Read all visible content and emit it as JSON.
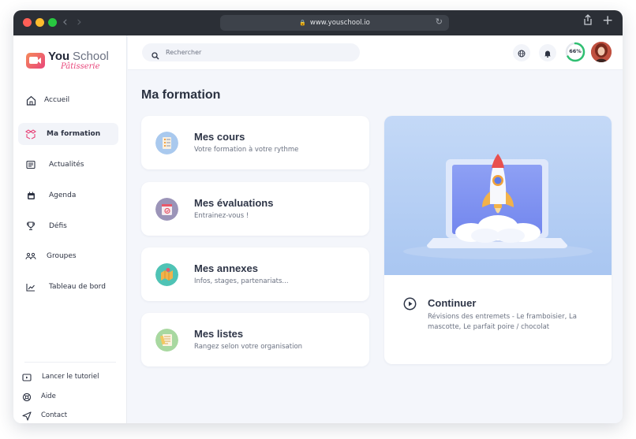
{
  "browser": {
    "url": "www.youschool.io",
    "traffic_colors": [
      "#ff5f57",
      "#febc2e",
      "#28c840"
    ]
  },
  "brand": {
    "name_bold": "You",
    "name_light": "School",
    "tagline": "Pâtisserie",
    "accent": "#e8457a"
  },
  "sidebar": {
    "items": [
      {
        "label": "Accueil",
        "icon": "home-icon"
      },
      {
        "label": "Ma formation",
        "icon": "formation-icon",
        "active": true
      },
      {
        "label": "Actualités",
        "icon": "news-icon"
      },
      {
        "label": "Agenda",
        "icon": "calendar-icon"
      },
      {
        "label": "Défis",
        "icon": "trophy-icon"
      },
      {
        "label": "Groupes",
        "icon": "group-icon"
      },
      {
        "label": "Tableau de bord",
        "icon": "chart-icon"
      }
    ],
    "footer": [
      {
        "label": "Lancer le tutoriel",
        "icon": "tutorial-icon"
      },
      {
        "label": "Aide",
        "icon": "help-icon"
      },
      {
        "label": "Contact",
        "icon": "send-icon"
      }
    ]
  },
  "topbar": {
    "search_placeholder": "Rechercher",
    "progress_label": "66%",
    "progress_value": 0.66,
    "progress_color": "#2fbf71"
  },
  "main": {
    "title": "Ma formation",
    "cards": [
      {
        "title": "Mes cours",
        "subtitle": "Votre formation à votre rythme",
        "icon": "courses-icon"
      },
      {
        "title": "Mes évaluations",
        "subtitle": "Entrainez-vous !",
        "icon": "evaluations-icon"
      },
      {
        "title": "Mes annexes",
        "subtitle": "Infos, stages, partenariats...",
        "icon": "annexes-icon"
      },
      {
        "title": "Mes listes",
        "subtitle": "Rangez selon votre organisation",
        "icon": "lists-icon"
      }
    ],
    "continue": {
      "title": "Continuer",
      "description": "Révisions des entremets - Le framboisier, La mascotte, Le parfait poire / chocolat",
      "icon": "play-circle-icon"
    }
  }
}
